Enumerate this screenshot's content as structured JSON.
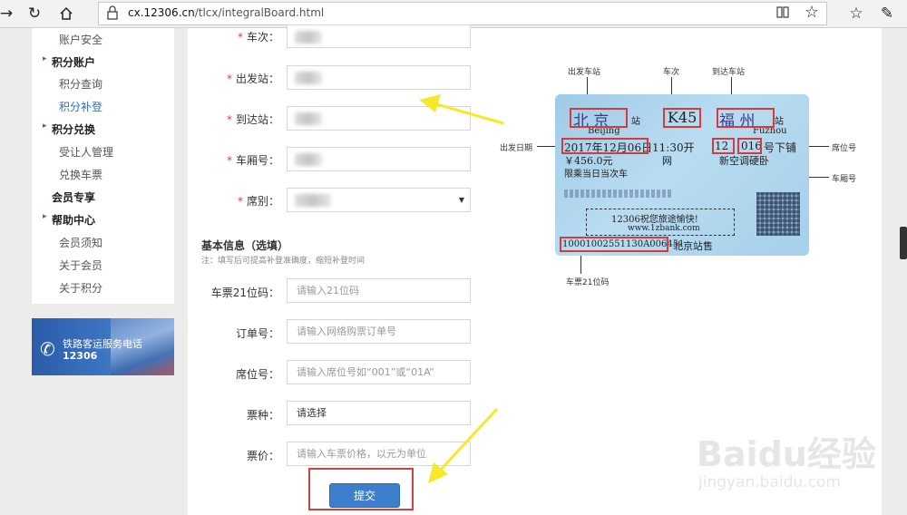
{
  "browser": {
    "url_domain": "cx.12306.cn",
    "url_path": "/tlcx/integralBoard.html"
  },
  "sidebar": {
    "items": [
      {
        "label": "账户安全",
        "type": "item"
      },
      {
        "label": "积分账户",
        "type": "head"
      },
      {
        "label": "积分查询",
        "type": "item"
      },
      {
        "label": "积分补登",
        "type": "item",
        "active": true
      },
      {
        "label": "积分兑换",
        "type": "head"
      },
      {
        "label": "受让人管理",
        "type": "item"
      },
      {
        "label": "兑换车票",
        "type": "item"
      },
      {
        "label": "会员专享",
        "type": "head-nodot"
      },
      {
        "label": "帮助中心",
        "type": "head"
      },
      {
        "label": "会员须知",
        "type": "item"
      },
      {
        "label": "关于会员",
        "type": "item"
      },
      {
        "label": "关于积分",
        "type": "item"
      }
    ],
    "banner_title": "铁路客运服务电话",
    "banner_number": "12306"
  },
  "form": {
    "required_fields": [
      {
        "label": "车次：",
        "value": ""
      },
      {
        "label": "出发站：",
        "value": ""
      },
      {
        "label": "到达站：",
        "value": ""
      },
      {
        "label": "车厢号：",
        "value": ""
      },
      {
        "label": "席别：",
        "value": ""
      }
    ],
    "section_title": "基本信息（选填）",
    "section_note": "注：填写后可提高补登准确度，缩短补登时间",
    "optional_fields": [
      {
        "label": "车票21位码：",
        "placeholder": "请输入21位码"
      },
      {
        "label": "订单号：",
        "placeholder": "请输入网络购票订单号"
      },
      {
        "label": "席位号：",
        "placeholder": "请输入席位号如“001”或“01A”"
      },
      {
        "label": "票种：",
        "value": "请选择"
      },
      {
        "label": "票价：",
        "placeholder": "请输入车票价格，以元为单位"
      }
    ],
    "submit_label": "提交"
  },
  "ticket_figure": {
    "annotations": {
      "departure_station": "出发车站",
      "train_no": "车次",
      "arrival_station": "到达车站",
      "departure_date": "出发日期",
      "seat_no": "席位号",
      "car_no": "车厢号",
      "code21": "车票21位码"
    },
    "ticket": {
      "from_cn": "北  京",
      "from_suffix": "站",
      "from_en": "Beijing",
      "train": "K45",
      "to_cn": "福  州",
      "to_suffix": "站",
      "to_en": "Fuzhou",
      "date": "2017年12月06日",
      "time": "11:30开",
      "car": "12",
      "seat": "016",
      "berth": "号下铺",
      "price": "￥456.0元",
      "seat_class": "新空调硬卧",
      "net": "网",
      "note": "限乘当日当次车",
      "slogan": "12306祝您旅途愉快!",
      "site": "www.1zbank.com",
      "code": "10001002551130A006451",
      "station": "北京站售"
    }
  },
  "watermark": {
    "brand": "Baidu经验",
    "url": "jingyan.baidu.com"
  },
  "colors": {
    "accent": "#2f6ebf",
    "required": "#e03c3c",
    "highlight_box": "#d63a3a",
    "arrow": "#f5e92a",
    "submit": "#3d7fcc"
  }
}
